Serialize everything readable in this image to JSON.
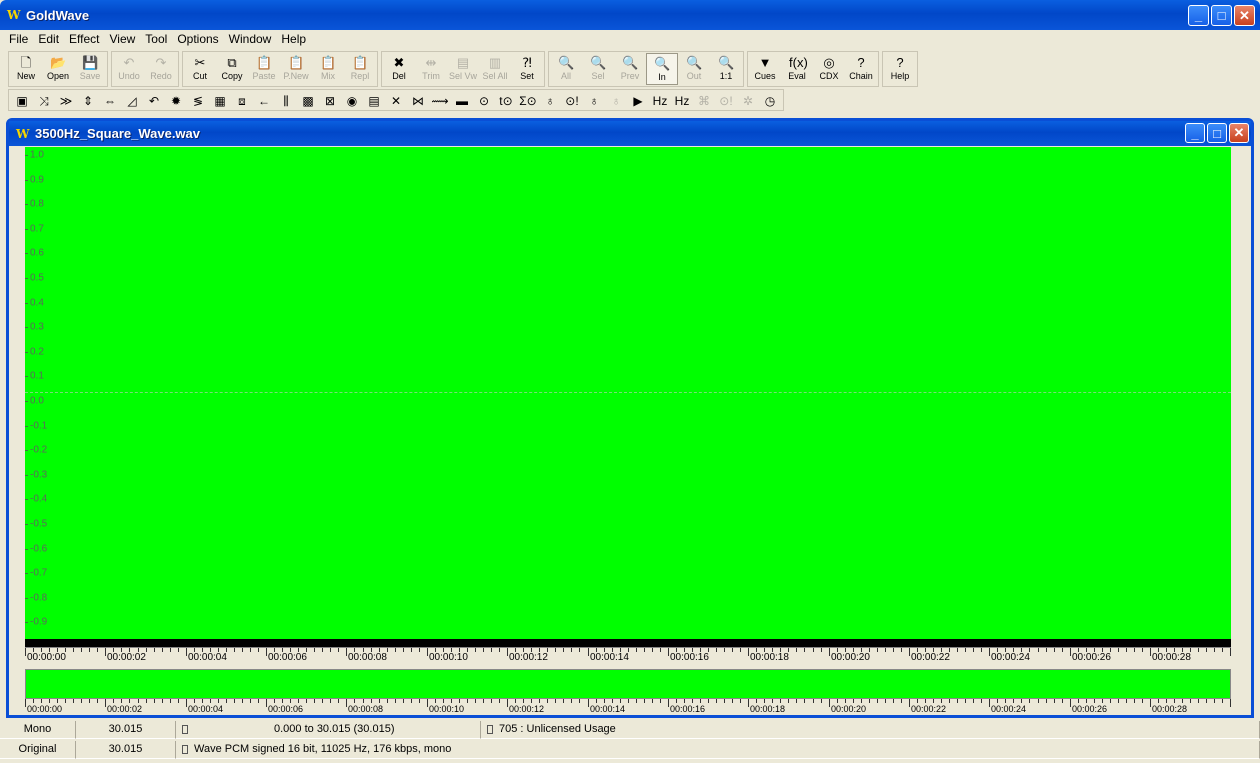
{
  "app": {
    "title": "GoldWave",
    "icon_glyph": "W"
  },
  "window_controls": {
    "minimize": "_",
    "maximize": "□",
    "close": "✕"
  },
  "menu": [
    "File",
    "Edit",
    "Effect",
    "View",
    "Tool",
    "Options",
    "Window",
    "Help"
  ],
  "toolbar1": [
    {
      "label": "New",
      "icon": "new-doc-icon",
      "glyph": "🗋",
      "disabled": false
    },
    {
      "label": "Open",
      "icon": "open-folder-icon",
      "glyph": "📂",
      "disabled": false
    },
    {
      "label": "Save",
      "icon": "save-disk-icon",
      "glyph": "💾",
      "disabled": true
    },
    {
      "label": "Undo",
      "icon": "undo-icon",
      "glyph": "↶",
      "disabled": true
    },
    {
      "label": "Redo",
      "icon": "redo-icon",
      "glyph": "↷",
      "disabled": true
    },
    {
      "label": "Cut",
      "icon": "scissors-icon",
      "glyph": "✂",
      "disabled": false
    },
    {
      "label": "Copy",
      "icon": "copy-icon",
      "glyph": "⧉",
      "disabled": false
    },
    {
      "label": "Paste",
      "icon": "paste-icon",
      "glyph": "📋",
      "disabled": true
    },
    {
      "label": "P.New",
      "icon": "paste-new-icon",
      "glyph": "📋",
      "disabled": true
    },
    {
      "label": "Mix",
      "icon": "mix-icon",
      "glyph": "📋",
      "disabled": true
    },
    {
      "label": "Repl",
      "icon": "replace-icon",
      "glyph": "📋",
      "disabled": true
    },
    {
      "label": "Del",
      "icon": "delete-icon",
      "glyph": "✖",
      "disabled": false
    },
    {
      "label": "Trim",
      "icon": "trim-icon",
      "glyph": "⇹",
      "disabled": true
    },
    {
      "label": "Sel Vw",
      "icon": "select-view-icon",
      "glyph": "▤",
      "disabled": true
    },
    {
      "label": "Sel All",
      "icon": "select-all-icon",
      "glyph": "▥",
      "disabled": true
    },
    {
      "label": "Set",
      "icon": "set-marker-icon",
      "glyph": "⁈",
      "disabled": false
    },
    {
      "label": "All",
      "icon": "zoom-all-icon",
      "glyph": "🔍",
      "disabled": true
    },
    {
      "label": "Sel",
      "icon": "zoom-select-icon",
      "glyph": "🔍",
      "disabled": true
    },
    {
      "label": "Prev",
      "icon": "zoom-prev-icon",
      "glyph": "🔍",
      "disabled": true
    },
    {
      "label": "In",
      "icon": "zoom-in-icon",
      "glyph": "🔍",
      "disabled": false
    },
    {
      "label": "Out",
      "icon": "zoom-out-icon",
      "glyph": "🔍",
      "disabled": true
    },
    {
      "label": "1:1",
      "icon": "zoom-1to1-icon",
      "glyph": "🔍",
      "disabled": false
    },
    {
      "label": "Cues",
      "icon": "cues-icon",
      "glyph": "▼",
      "disabled": false
    },
    {
      "label": "Eval",
      "icon": "eval-fx-icon",
      "glyph": "f(x)",
      "disabled": false
    },
    {
      "label": "CDX",
      "icon": "cd-icon",
      "glyph": "◎",
      "disabled": false
    },
    {
      "label": "Chain",
      "icon": "chain-icon",
      "glyph": "?",
      "disabled": false
    },
    {
      "label": "Help",
      "icon": "help-icon",
      "glyph": "?",
      "disabled": false
    }
  ],
  "toolbar2": [
    {
      "icon": "effect-auto-gain-icon",
      "glyph": "▣",
      "disabled": false
    },
    {
      "icon": "effect-swap-icon",
      "glyph": "⤨",
      "disabled": false
    },
    {
      "icon": "effect-channel-icon",
      "glyph": "≫",
      "disabled": false
    },
    {
      "icon": "effect-expand-icon",
      "glyph": "⇕",
      "disabled": false
    },
    {
      "icon": "effect-compress-icon",
      "glyph": "⇔",
      "disabled": false
    },
    {
      "icon": "effect-fade-icon",
      "glyph": "◿",
      "disabled": false
    },
    {
      "icon": "effect-invert-icon",
      "glyph": "↶",
      "disabled": false
    },
    {
      "icon": "effect-noise-icon",
      "glyph": "✹",
      "disabled": false
    },
    {
      "icon": "effect-pitch-icon",
      "glyph": "≶",
      "disabled": false
    },
    {
      "icon": "effect-equalizer-icon",
      "glyph": "▦",
      "disabled": false
    },
    {
      "icon": "effect-filter-icon",
      "glyph": "⧈",
      "disabled": false
    },
    {
      "icon": "effect-offset-icon",
      "glyph": "←",
      "disabled": false
    },
    {
      "icon": "effect-parametric-icon",
      "glyph": "⫼",
      "disabled": false
    },
    {
      "icon": "effect-spectrum-icon",
      "glyph": "▩",
      "disabled": false
    },
    {
      "icon": "effect-declick-icon",
      "glyph": "⊠",
      "disabled": false
    },
    {
      "icon": "effect-noise-reduction-icon",
      "glyph": "◉",
      "disabled": false
    },
    {
      "icon": "effect-multiband-icon",
      "glyph": "▤",
      "disabled": false
    },
    {
      "icon": "effect-reverb-icon",
      "glyph": "✕",
      "disabled": false
    },
    {
      "icon": "effect-echo-icon",
      "glyph": "⋈",
      "disabled": false
    },
    {
      "icon": "effect-doppler-icon",
      "glyph": "⟿",
      "disabled": false
    },
    {
      "icon": "effect-rainbow-icon",
      "glyph": "▬",
      "disabled": false
    },
    {
      "icon": "effect-playback-rate-icon",
      "glyph": "⊙",
      "disabled": false
    },
    {
      "icon": "effect-volume-icon",
      "glyph": "t⊙",
      "disabled": false
    },
    {
      "icon": "effect-shape-icon",
      "glyph": "Σ⊙",
      "disabled": false
    },
    {
      "icon": "effect-resample-icon",
      "glyph": "♁",
      "disabled": false
    },
    {
      "icon": "effect-silence-icon",
      "glyph": "⊙!",
      "disabled": false
    },
    {
      "icon": "effect-time-warp-icon",
      "glyph": "♁",
      "disabled": false
    },
    {
      "icon": "effect-mech-icon",
      "glyph": "♁",
      "disabled": true
    },
    {
      "icon": "effect-play-icon",
      "glyph": "▶",
      "disabled": false
    },
    {
      "icon": "effect-hz-icon",
      "glyph": "Hz",
      "disabled": false
    },
    {
      "icon": "effect-hz-wave-icon",
      "glyph": "Hz",
      "disabled": false
    },
    {
      "icon": "effect-stereo-icon",
      "glyph": "⌘",
      "disabled": true
    },
    {
      "icon": "effect-alarm-icon",
      "glyph": "⊙!",
      "disabled": true
    },
    {
      "icon": "effect-vocal-icon",
      "glyph": "✲",
      "disabled": true
    },
    {
      "icon": "effect-timer-icon",
      "glyph": "◷",
      "disabled": false
    }
  ],
  "document": {
    "title": "3500Hz_Square_Wave.wav",
    "icon_glyph": "W",
    "waveform_color": "#00ff00",
    "y_labels": [
      "1.0",
      "0.9",
      "0.8",
      "0.7",
      "0.6",
      "0.5",
      "0.4",
      "0.3",
      "0.2",
      "0.1",
      "0.0",
      "-0.1",
      "-0.2",
      "-0.3",
      "-0.4",
      "-0.5",
      "-0.6",
      "-0.7",
      "-0.8",
      "-0.9"
    ],
    "time_labels": [
      "00:00:00",
      "00:00:02",
      "00:00:04",
      "00:00:06",
      "00:00:08",
      "00:00:10",
      "00:00:12",
      "00:00:14",
      "00:00:16",
      "00:00:18",
      "00:00:20",
      "00:00:22",
      "00:00:24",
      "00:00:26",
      "00:00:28"
    ],
    "overview_time_labels": [
      "00:00:00",
      "00:00:02",
      "00:00:04",
      "00:00:06",
      "00:00:08",
      "00:00:10",
      "00:00:12",
      "00:00:14",
      "00:00:16",
      "00:00:18",
      "00:00:20",
      "00:00:22",
      "00:00:24",
      "00:00:26",
      "00:00:28"
    ],
    "visible_seconds": 30.015
  },
  "status": {
    "row1": {
      "channels": "Mono",
      "length": "30.015",
      "selection": "0.000 to 30.015 (30.015)",
      "license": "705 : Unlicensed Usage"
    },
    "row2": {
      "state": "Original",
      "length": "30.015",
      "format": "Wave PCM signed 16 bit, 11025 Hz, 176 kbps, mono"
    }
  }
}
